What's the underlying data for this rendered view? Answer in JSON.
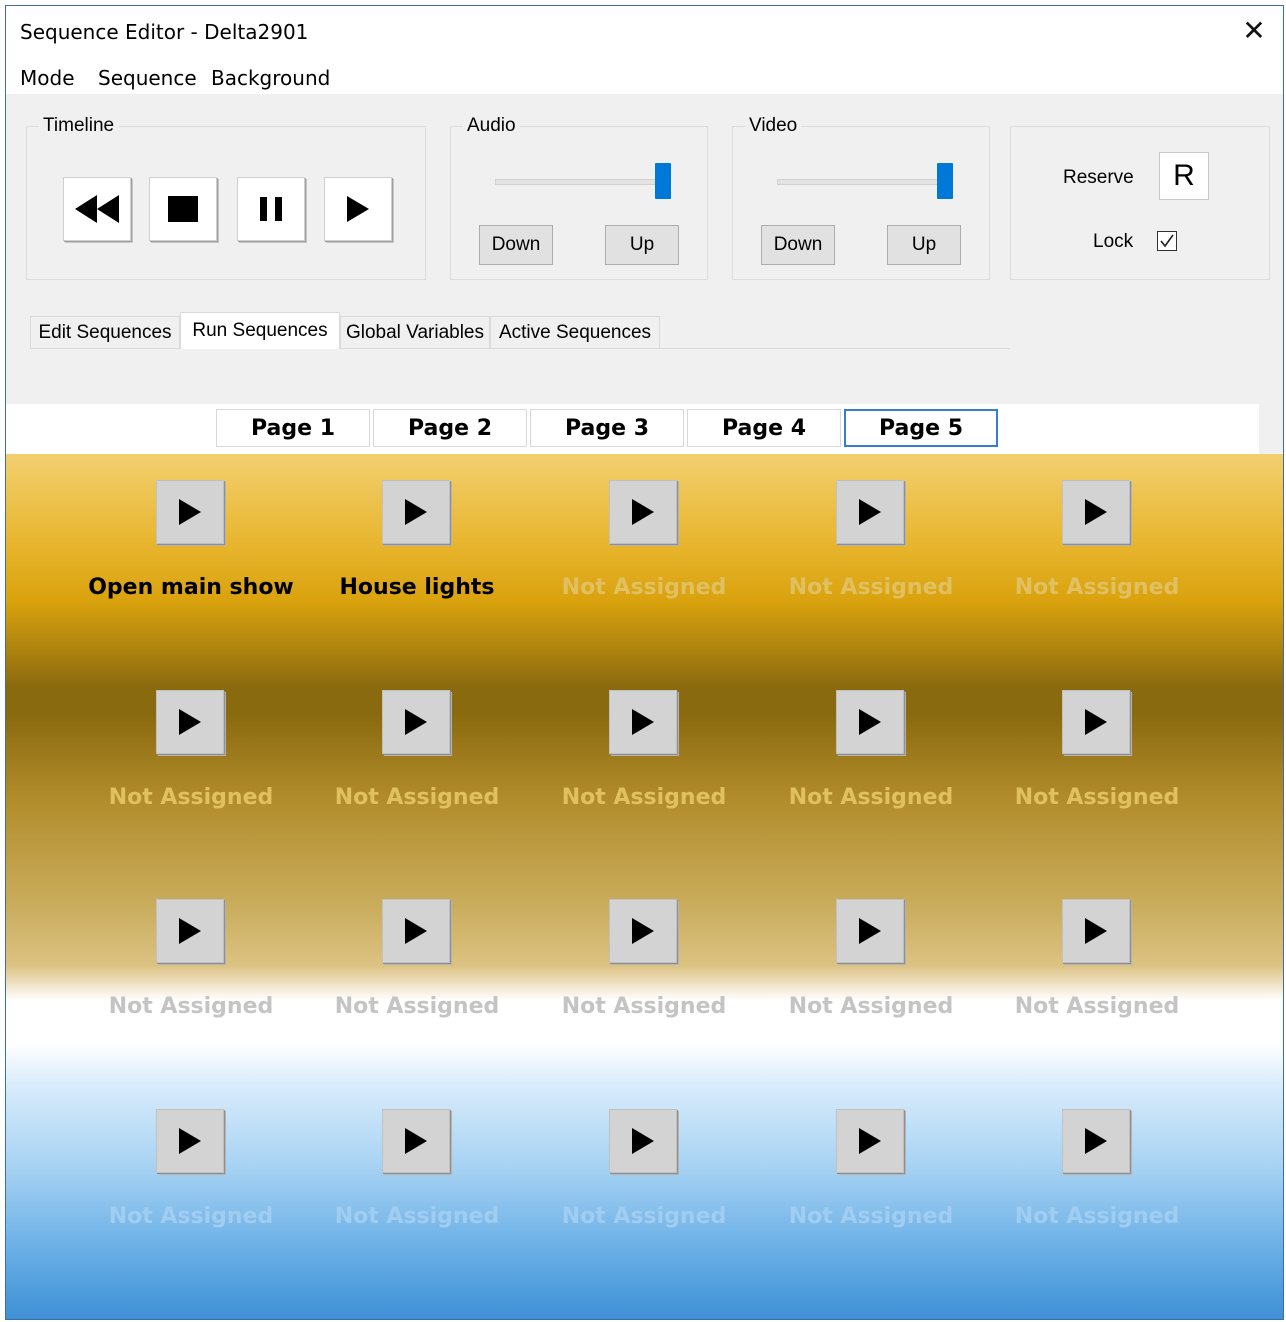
{
  "window": {
    "title": "Sequence Editor - Delta2901",
    "close_glyph": "✕"
  },
  "menu": [
    "Mode",
    "Sequence",
    "Background"
  ],
  "timeline": {
    "label": "Timeline",
    "buttons": [
      {
        "name": "rewind-button",
        "icon": "rewind-icon"
      },
      {
        "name": "stop-button",
        "icon": "stop-icon"
      },
      {
        "name": "pause-button",
        "icon": "pause-icon"
      },
      {
        "name": "play-button",
        "icon": "play-icon"
      }
    ]
  },
  "audio": {
    "label": "Audio",
    "level": 1.0,
    "down_label": "Down",
    "up_label": "Up"
  },
  "video": {
    "label": "Video",
    "level": 1.0,
    "down_label": "Down",
    "up_label": "Up"
  },
  "reserve": {
    "label": "Reserve",
    "value": "R",
    "lock_label": "Lock",
    "lock_checked": true,
    "check_glyph": "✓"
  },
  "tabs": [
    {
      "label": "Edit Sequences",
      "active": false
    },
    {
      "label": "Run Sequences",
      "active": true
    },
    {
      "label": "Global Variables",
      "active": false
    },
    {
      "label": "Active Sequences",
      "active": false
    }
  ],
  "pages": [
    {
      "label": "Page 1",
      "active": false
    },
    {
      "label": "Page 2",
      "active": false
    },
    {
      "label": "Page 3",
      "active": false
    },
    {
      "label": "Page 4",
      "active": false
    },
    {
      "label": "Page 5",
      "active": true
    }
  ],
  "sequence_grid": [
    [
      "Open main show",
      "House lights",
      "Not Assigned",
      "Not Assigned",
      "Not Assigned"
    ],
    [
      "Not Assigned",
      "Not Assigned",
      "Not Assigned",
      "Not Assigned",
      "Not Assigned"
    ],
    [
      "Not Assigned",
      "Not Assigned",
      "Not Assigned",
      "Not Assigned",
      "Not Assigned"
    ],
    [
      "Not Assigned",
      "Not Assigned",
      "Not Assigned",
      "Not Assigned",
      "Not Assigned"
    ]
  ],
  "colors": {
    "accent": "#0078d7",
    "active_page_border": "#3a7bd5"
  }
}
